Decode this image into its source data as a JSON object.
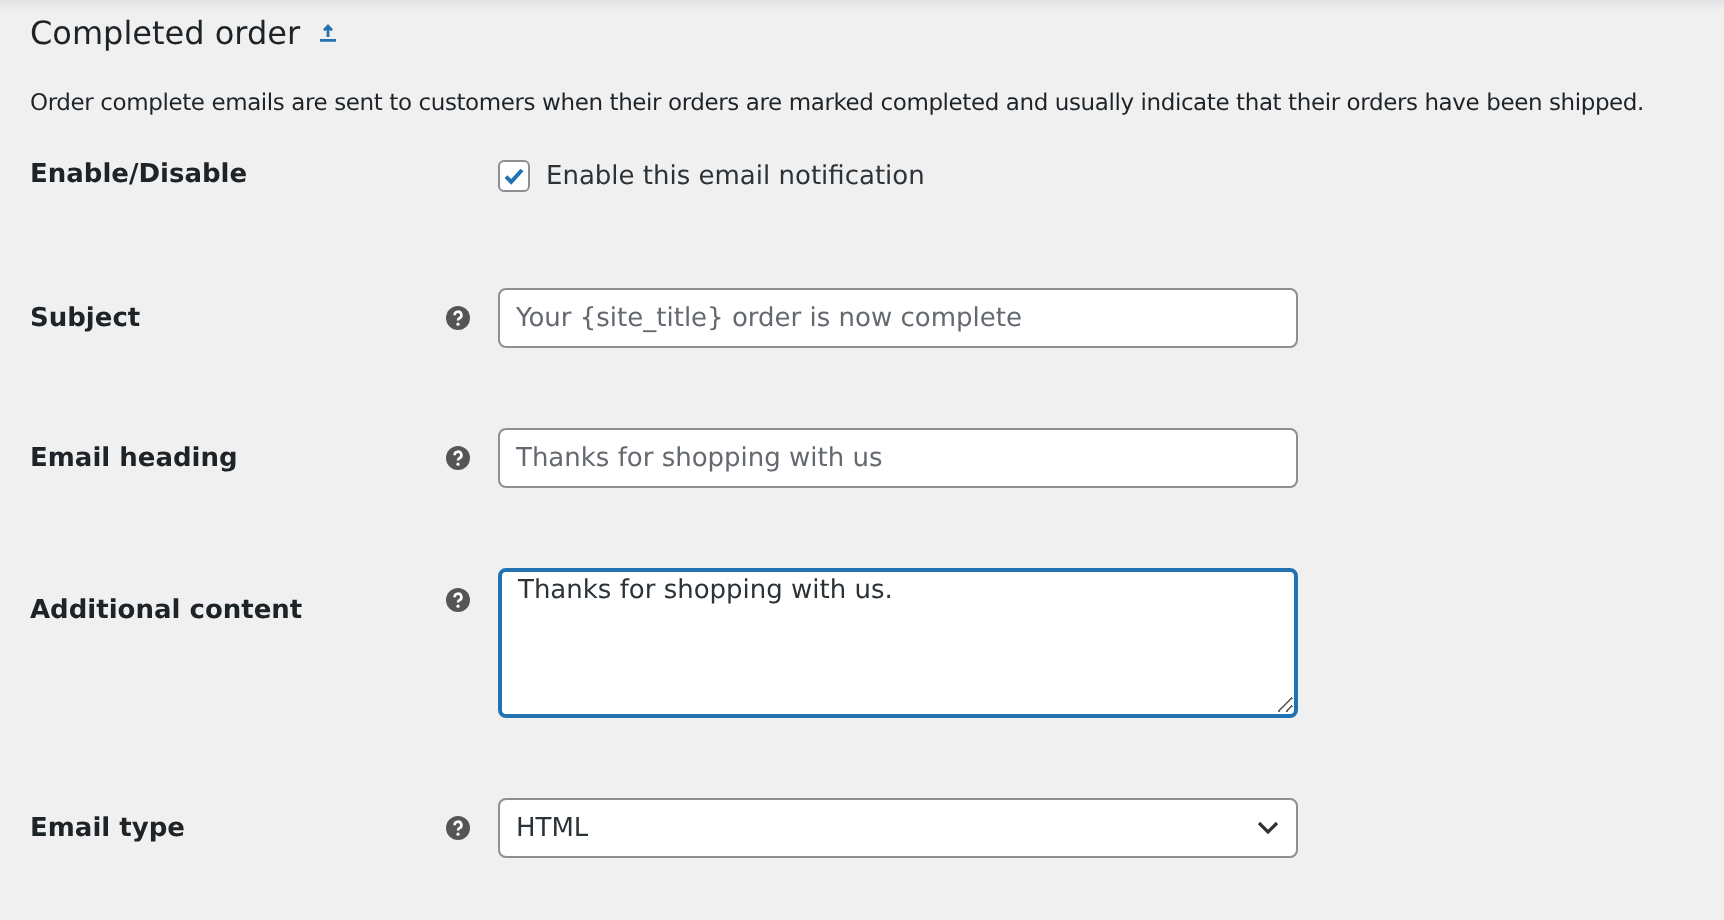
{
  "heading": {
    "title": "Completed order",
    "description": "Order complete emails are sent to customers when their orders are marked completed and usually indicate that their orders have been shipped."
  },
  "fields": [
    {
      "kind": "checkbox",
      "label": "Enable/Disable",
      "help": false,
      "checked": true,
      "text": "Enable this email notification"
    },
    {
      "kind": "text",
      "label": "Subject",
      "help": true,
      "placeholder": "Your {site_title} order is now complete"
    },
    {
      "kind": "text",
      "label": "Email heading",
      "help": true,
      "placeholder": "Thanks for shopping with us"
    },
    {
      "kind": "textarea",
      "label": "Additional content",
      "help": true,
      "value": "Thanks for shopping with us.",
      "focused": true
    },
    {
      "kind": "select",
      "label": "Email type",
      "help": true,
      "value": "HTML"
    }
  ]
}
